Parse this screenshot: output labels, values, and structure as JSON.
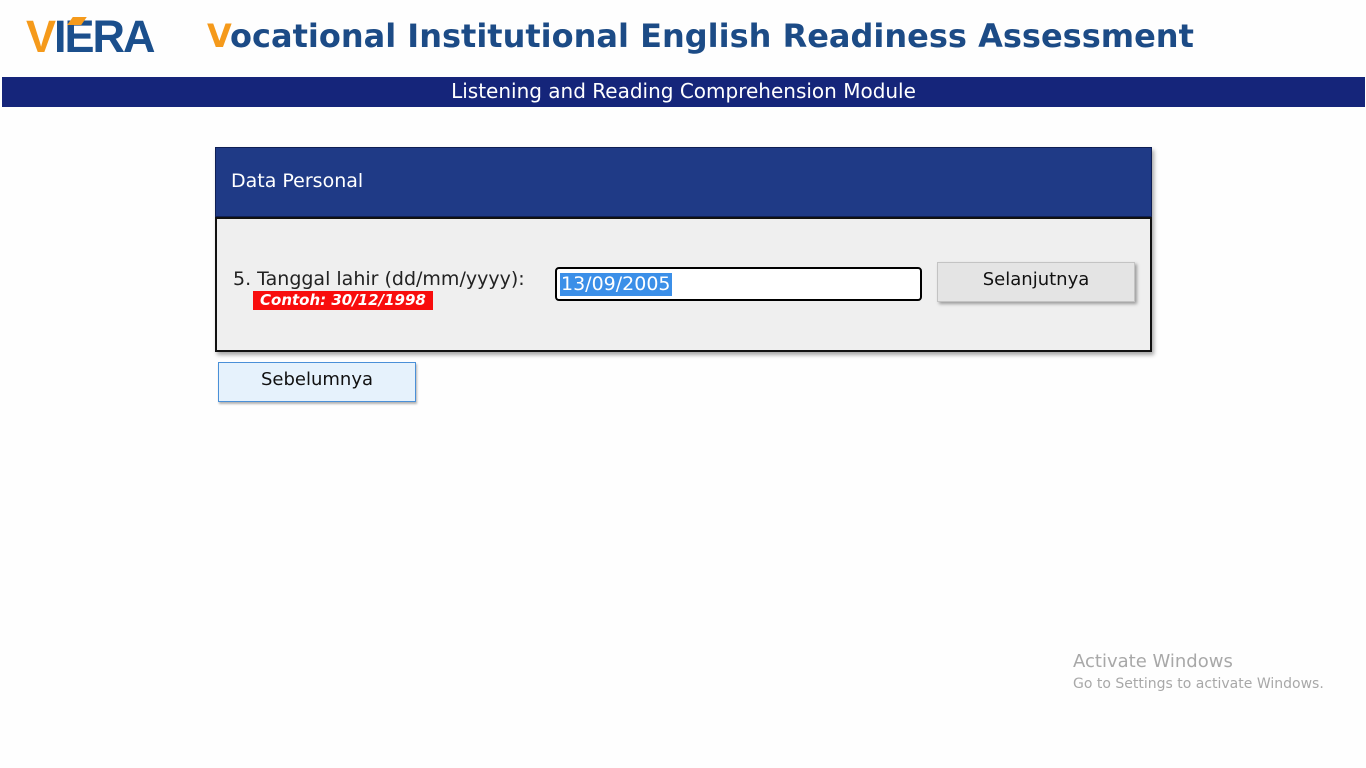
{
  "header": {
    "logo": {
      "first_letter": "V",
      "rest": "IERA"
    },
    "title": {
      "first_letter": "V",
      "rest": "ocational Institutional English Readiness Assessment"
    },
    "module": "Listening and Reading Comprehension Module"
  },
  "colors": {
    "accent_orange": "#f59a1b",
    "brand_blue": "#1c4b86",
    "module_bar": "#15257a",
    "panel_header": "#1f3a86",
    "example_badge_red": "#f80d0d",
    "selection_blue": "#3b8fe8"
  },
  "panel": {
    "title": "Data Personal",
    "question": "5. Tanggal lahir (dd/mm/yyyy):",
    "example": "Contoh: 30/12/1998",
    "input_value": "13/09/2005",
    "next_label": "Selanjutnya"
  },
  "navigation": {
    "prev_label": "Sebelumnya"
  },
  "watermark": {
    "title": "Activate Windows",
    "subtitle": "Go to Settings to activate Windows."
  }
}
